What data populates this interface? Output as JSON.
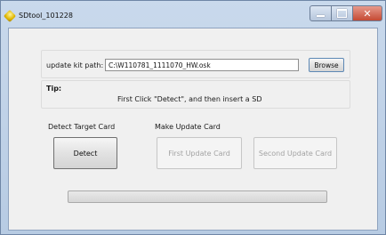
{
  "window": {
    "title": "SDtool_101228"
  },
  "path": {
    "label": "update kit path:",
    "value": "C:\\W110781_1111070_HW.osk",
    "browse_label": "Browse"
  },
  "tip": {
    "label": "Tip:",
    "text": "First Click \"Detect\",  and then insert a SD"
  },
  "detect_section": {
    "label": "Detect Target Card",
    "button_label": "Detect"
  },
  "update_section": {
    "label": "Make Update Card",
    "first_button_label": "First Update Card",
    "second_button_label": "Second Update Card"
  },
  "progress": {
    "value": 0
  }
}
